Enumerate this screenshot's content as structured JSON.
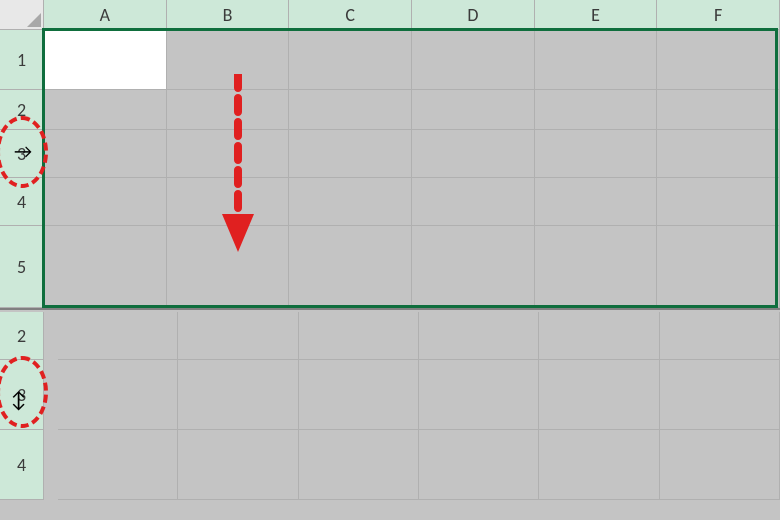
{
  "columns": [
    "A",
    "B",
    "C",
    "D",
    "E",
    "F"
  ],
  "upperRows": [
    {
      "label": "1",
      "height": 60
    },
    {
      "label": "2",
      "height": 40
    },
    {
      "label": "3",
      "height": 48
    },
    {
      "label": "4",
      "height": 48
    },
    {
      "label": "5",
      "height": 82
    }
  ],
  "lowerRows": [
    {
      "label": "2",
      "height": 48
    },
    {
      "label": "3",
      "height": 70
    },
    {
      "label": "4",
      "height": 70
    }
  ],
  "activeCell": {
    "row": 0,
    "col": 0
  },
  "colors": {
    "selectionBorder": "#0f6e3d",
    "headerSelected": "#cde8d8",
    "annotation": "#e02020"
  },
  "annotations": {
    "arrow": {
      "direction": "down"
    },
    "ellipses": [
      "row3-upper",
      "row3-lower"
    ],
    "cursors": [
      "right-arrow",
      "resize-vertical"
    ]
  }
}
